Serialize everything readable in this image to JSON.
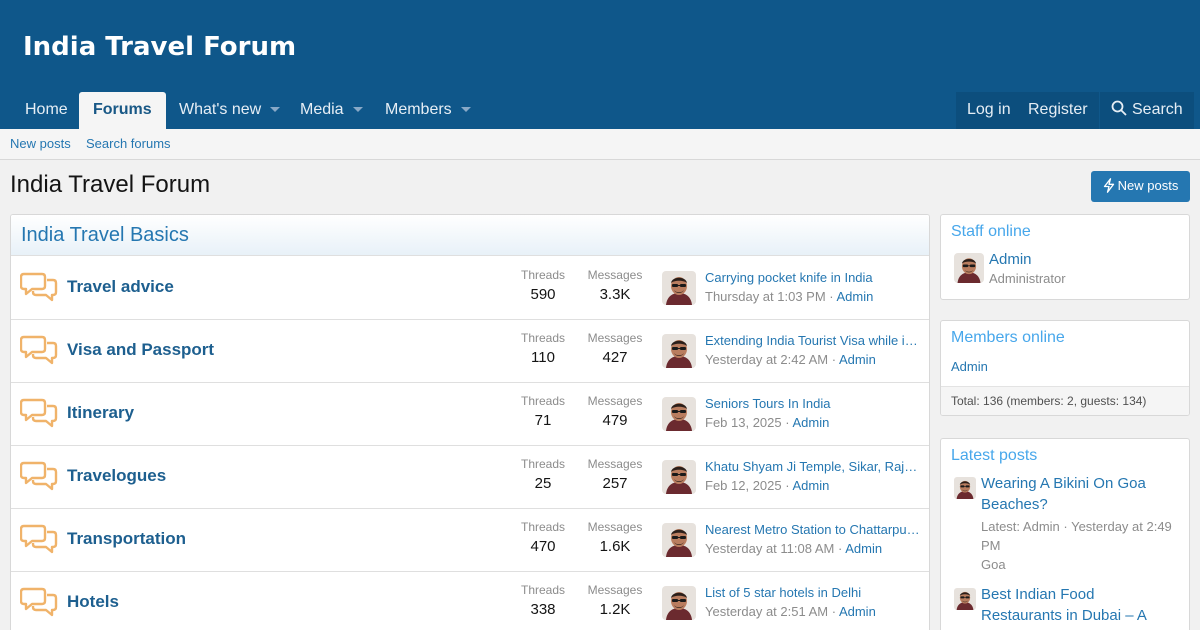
{
  "site": {
    "title": "India Travel Forum"
  },
  "nav": {
    "home": "Home",
    "forums": "Forums",
    "whats_new": "What's new",
    "media": "Media",
    "members": "Members",
    "login": "Log in",
    "register": "Register",
    "search": "Search"
  },
  "subnav": {
    "new_posts": "New posts",
    "search_forums": "Search forums"
  },
  "page": {
    "title": "India Travel Forum",
    "new_posts_button": "New posts"
  },
  "category": {
    "title": "India Travel Basics",
    "threads_label": "Threads",
    "messages_label": "Messages",
    "nodes": [
      {
        "title": "Travel advice",
        "threads": "590",
        "messages": "3.3K",
        "latest_title": "Carrying pocket knife in India",
        "latest_date": "Thursday at 1:03 PM",
        "latest_user": "Admin"
      },
      {
        "title": "Visa and Passport",
        "threads": "110",
        "messages": "427",
        "latest_title": "Extending India Tourist Visa while in…",
        "latest_date": "Yesterday at 2:42 AM",
        "latest_user": "Admin"
      },
      {
        "title": "Itinerary",
        "threads": "71",
        "messages": "479",
        "latest_title": "Seniors Tours In India",
        "latest_date": "Feb 13, 2025",
        "latest_user": "Admin"
      },
      {
        "title": "Travelogues",
        "threads": "25",
        "messages": "257",
        "latest_title": "Khatu Shyam Ji Temple, Sikar, Raja…",
        "latest_date": "Feb 12, 2025",
        "latest_user": "Admin"
      },
      {
        "title": "Transportation",
        "threads": "470",
        "messages": "1.6K",
        "latest_title": "Nearest Metro Station to Chattarpur …",
        "latest_date": "Yesterday at 11:08 AM",
        "latest_user": "Admin"
      },
      {
        "title": "Hotels",
        "threads": "338",
        "messages": "1.2K",
        "latest_title": "List of 5 star hotels in Delhi",
        "latest_date": "Yesterday at 2:51 AM",
        "latest_user": "Admin"
      }
    ]
  },
  "staff_online": {
    "title": "Staff online",
    "name": "Admin",
    "role": "Administrator"
  },
  "members_online": {
    "title": "Members online",
    "member": "Admin",
    "total": "Total: 136 (members: 2, guests: 134)"
  },
  "latest_posts": {
    "title": "Latest posts",
    "items": [
      {
        "title": "Wearing A Bikini On Goa Beaches?",
        "meta": "Latest: Admin · Yesterday at 2:49 PM",
        "forum": "Goa"
      },
      {
        "title": "Best Indian Food Restaurants in Dubai – A Food Lover’s",
        "meta": "",
        "forum": ""
      }
    ]
  },
  "icons": {
    "forum": "speech-bubbles-icon",
    "search": "magnifier-icon",
    "new_posts": "lightning-bolt-icon"
  },
  "colors": {
    "header": "#0f578a",
    "link": "#2577b1",
    "node_title": "#1d5f8f",
    "icon": "#f0b36a"
  }
}
